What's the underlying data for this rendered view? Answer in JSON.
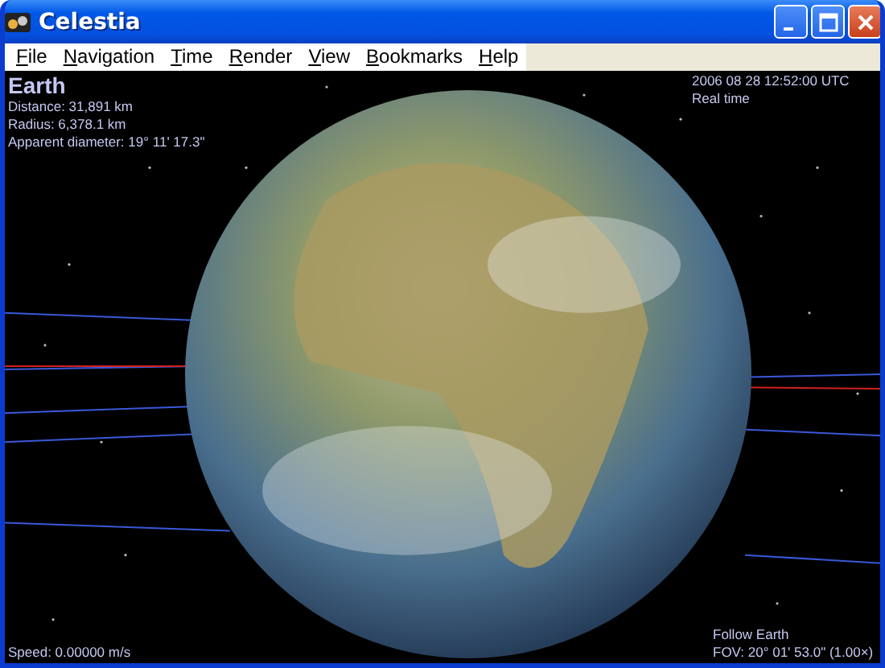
{
  "window": {
    "title": "Celestia"
  },
  "menu": [
    {
      "label": "File"
    },
    {
      "label": "Navigation"
    },
    {
      "label": "Time"
    },
    {
      "label": "Render"
    },
    {
      "label": "View"
    },
    {
      "label": "Bookmarks"
    },
    {
      "label": "Help"
    }
  ],
  "hud": {
    "object_name": "Earth",
    "info": [
      "Distance: 31,891 km",
      "Radius: 6,378.1 km",
      "Apparent diameter: 19° 11' 17.3\""
    ],
    "time": "2006 08 28 12:52:00 UTC",
    "time_mode": "Real time",
    "follow": "Follow Earth",
    "fov": "FOV: 20° 01' 53.0\" (1.00×)",
    "speed": "Speed: 0.00000 m/s"
  }
}
